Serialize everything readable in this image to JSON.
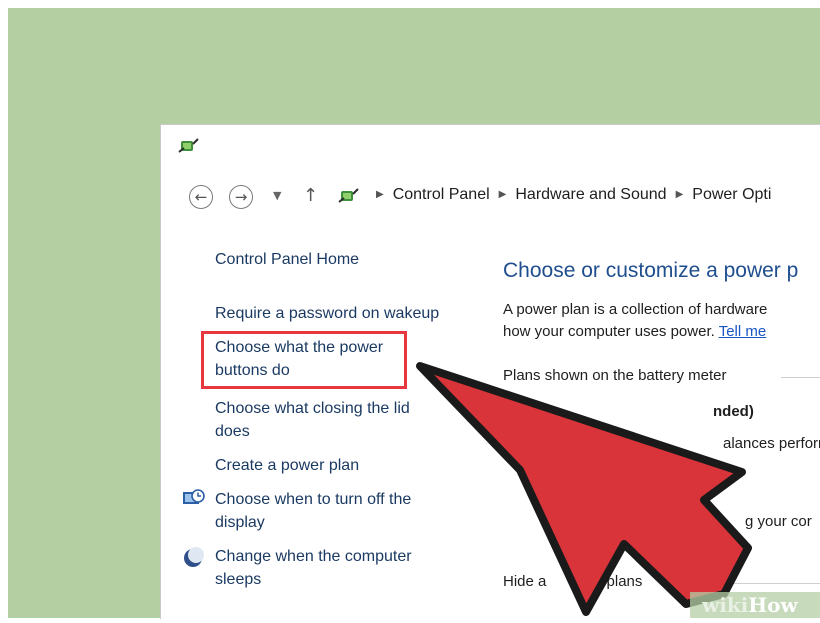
{
  "breadcrumb": {
    "items": [
      "Control Panel",
      "Hardware and Sound",
      "Power Opti"
    ]
  },
  "sidebar": {
    "home": "Control Panel Home",
    "password": "Require a password on wakeup",
    "power_buttons": "Choose what the power buttons do",
    "lid": "Choose what closing the lid does",
    "create_plan": "Create a power plan",
    "turn_off_display": "Choose when to turn off the display",
    "sleep": "Change when the computer sleeps"
  },
  "main": {
    "heading": "Choose or customize a power p",
    "desc_line1": "A power plan is a collection of hardware",
    "desc_line2": "how your computer uses power.",
    "tell_me": "Tell me",
    "section": "Plans shown on the battery meter",
    "plan_name_partial": "nded)",
    "plan_desc_partial": "alances performan",
    "cor_partial": "g your cor",
    "hide_prefix": "Hide a",
    "hide_suffix": "nal plans"
  },
  "watermark": {
    "wiki": "wiki",
    "how": "How"
  },
  "colors": {
    "background_green": "#b4cfa2",
    "link_blue": "#1b3a63",
    "heading_blue": "#1f4e8f",
    "highlight_red": "#e8363f",
    "arrow_red": "#d8343a"
  },
  "icons": {
    "title": "power-options-icon",
    "back": "back-arrow-icon",
    "forward": "forward-arrow-icon",
    "up": "up-arrow-icon",
    "display_timer": "display-clock-icon",
    "sleep_moon": "moon-icon",
    "pointer": "red-arrow-pointer"
  }
}
